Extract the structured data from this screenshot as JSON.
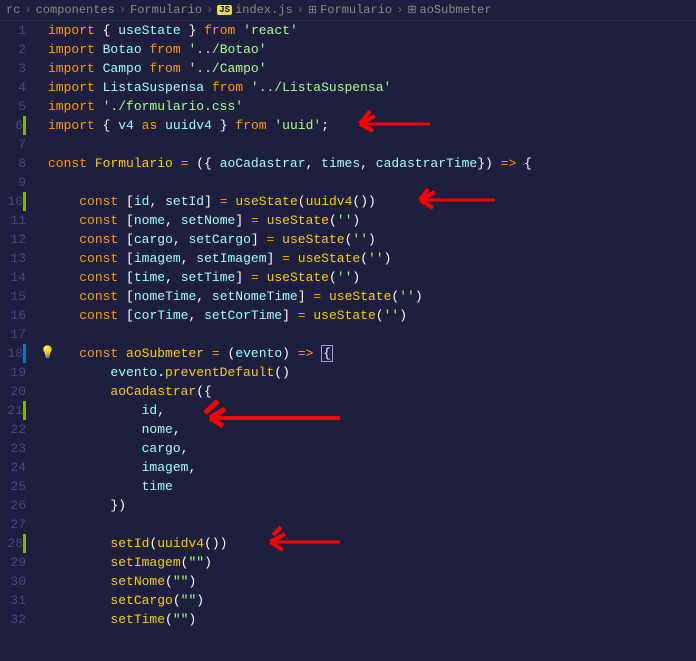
{
  "breadcrumbs": {
    "items": [
      "rc",
      "componentes",
      "Formulario",
      "index.js",
      "Formulario",
      "aoSubmeter"
    ]
  },
  "lines": {
    "1": {
      "n": "1",
      "html": "<span class='kw'>import</span> <span class='punct'>{</span> <span class='ident'>useState</span> <span class='punct'>}</span> <span class='kw'>from</span> <span class='str'>'react'</span>"
    },
    "2": {
      "n": "2",
      "html": "<span class='kw'>import</span> <span class='ident'>Botao</span> <span class='kw'>from</span> <span class='str'>'../Botao'</span>"
    },
    "3": {
      "n": "3",
      "html": "<span class='kw'>import</span> <span class='ident'>Campo</span> <span class='kw'>from</span> <span class='str'>'../Campo'</span>"
    },
    "4": {
      "n": "4",
      "html": "<span class='kw'>import</span> <span class='ident'>ListaSuspensa</span> <span class='kw'>from</span> <span class='str'>'../ListaSuspensa'</span>"
    },
    "5": {
      "n": "5",
      "html": "<span class='kw'>import</span> <span class='str'>'./formulario.css'</span>"
    },
    "6": {
      "n": "6",
      "html": "<span class='kw'>import</span> <span class='punct'>{</span> <span class='ident'>v4</span> <span class='kw'>as</span> <span class='ident'>uuidv4</span> <span class='punct'>}</span> <span class='kw'>from</span> <span class='str'>'uuid'</span><span class='punct'>;</span>"
    },
    "7": {
      "n": "7",
      "html": ""
    },
    "8": {
      "n": "8",
      "html": "<span class='kw'>const</span> <span class='func'>Formulario</span> <span class='op'>=</span> <span class='punct'>({</span> <span class='param'>aoCadastrar</span><span class='punct'>,</span> <span class='param'>times</span><span class='punct'>,</span> <span class='param'>cadastrarTime</span><span class='punct'>})</span> <span class='op'>=&gt;</span> <span class='punct'>{</span>"
    },
    "9": {
      "n": "9",
      "html": ""
    },
    "10": {
      "n": "10",
      "html": "    <span class='kw'>const</span> <span class='punct'>[</span><span class='const-name'>id</span><span class='punct'>,</span> <span class='const-name'>setId</span><span class='punct'>]</span> <span class='op'>=</span> <span class='func'>useState</span><span class='punct'>(</span><span class='func'>uuidv4</span><span class='punct'>())</span>"
    },
    "11": {
      "n": "11",
      "html": "    <span class='kw'>const</span> <span class='punct'>[</span><span class='const-name'>nome</span><span class='punct'>,</span> <span class='const-name'>setNome</span><span class='punct'>]</span> <span class='op'>=</span> <span class='func'>useState</span><span class='punct'>(</span><span class='str'>''</span><span class='punct'>)</span>"
    },
    "12": {
      "n": "12",
      "html": "    <span class='kw'>const</span> <span class='punct'>[</span><span class='const-name'>cargo</span><span class='punct'>,</span> <span class='const-name'>setCargo</span><span class='punct'>]</span> <span class='op'>=</span> <span class='func'>useState</span><span class='punct'>(</span><span class='str'>''</span><span class='punct'>)</span>"
    },
    "13": {
      "n": "13",
      "html": "    <span class='kw'>const</span> <span class='punct'>[</span><span class='const-name'>imagem</span><span class='punct'>,</span> <span class='const-name'>setImagem</span><span class='punct'>]</span> <span class='op'>=</span> <span class='func'>useState</span><span class='punct'>(</span><span class='str'>''</span><span class='punct'>)</span>"
    },
    "14": {
      "n": "14",
      "html": "    <span class='kw'>const</span> <span class='punct'>[</span><span class='const-name'>time</span><span class='punct'>,</span> <span class='const-name'>setTime</span><span class='punct'>]</span> <span class='op'>=</span> <span class='func'>useState</span><span class='punct'>(</span><span class='str'>''</span><span class='punct'>)</span>"
    },
    "15": {
      "n": "15",
      "html": "    <span class='kw'>const</span> <span class='punct'>[</span><span class='const-name'>nomeTime</span><span class='punct'>,</span> <span class='const-name'>setNomeTime</span><span class='punct'>]</span> <span class='op'>=</span> <span class='func'>useState</span><span class='punct'>(</span><span class='str'>''</span><span class='punct'>)</span>"
    },
    "16": {
      "n": "16",
      "html": "    <span class='kw'>const</span> <span class='punct'>[</span><span class='const-name'>corTime</span><span class='punct'>,</span> <span class='const-name'>setCorTime</span><span class='punct'>]</span> <span class='op'>=</span> <span class='func'>useState</span><span class='punct'>(</span><span class='str'>''</span><span class='punct'>)</span>"
    },
    "17": {
      "n": "17",
      "html": ""
    },
    "18": {
      "n": "18",
      "html": "    <span class='kw'>const</span> <span class='func'>aoSubmeter</span> <span class='op'>=</span> <span class='punct'>(</span><span class='param'>evento</span><span class='punct'>)</span> <span class='op'>=&gt;</span> <span class='cursor-box'><span class='punct'>{</span></span>"
    },
    "19": {
      "n": "19",
      "html": "        <span class='prop'>evento</span><span class='punct'>.</span><span class='method'>preventDefault</span><span class='punct'>()</span>"
    },
    "20": {
      "n": "20",
      "html": "        <span class='func'>aoCadastrar</span><span class='punct'>({</span>"
    },
    "21": {
      "n": "21",
      "html": "            <span class='prop'>id</span><span class='punct'>,</span>"
    },
    "22": {
      "n": "22",
      "html": "            <span class='prop'>nome</span><span class='punct'>,</span>"
    },
    "23": {
      "n": "23",
      "html": "            <span class='prop'>cargo</span><span class='punct'>,</span>"
    },
    "24": {
      "n": "24",
      "html": "            <span class='prop'>imagem</span><span class='punct'>,</span>"
    },
    "25": {
      "n": "25",
      "html": "            <span class='prop'>time</span>"
    },
    "26": {
      "n": "26",
      "html": "        <span class='punct'>})</span>"
    },
    "27": {
      "n": "27",
      "html": ""
    },
    "28": {
      "n": "28",
      "html": "        <span class='func'>setId</span><span class='punct'>(</span><span class='func'>uuidv4</span><span class='punct'>())</span>"
    },
    "29": {
      "n": "29",
      "html": "        <span class='func'>setImagem</span><span class='punct'>(</span><span class='str'>\"\"</span><span class='punct'>)</span>"
    },
    "30": {
      "n": "30",
      "html": "        <span class='func'>setNome</span><span class='punct'>(</span><span class='str'>\"\"</span><span class='punct'>)</span>"
    },
    "31": {
      "n": "31",
      "html": "        <span class='func'>setCargo</span><span class='punct'>(</span><span class='str'>\"\"</span><span class='punct'>)</span>"
    },
    "32": {
      "n": "32",
      "html": "        <span class='func'>setTime</span><span class='punct'>(</span><span class='str'>\"\"</span><span class='punct'>)</span>"
    }
  },
  "modifiedLines": [
    "6",
    "10",
    "21",
    "28"
  ],
  "modifiedBlue": [
    "18"
  ]
}
